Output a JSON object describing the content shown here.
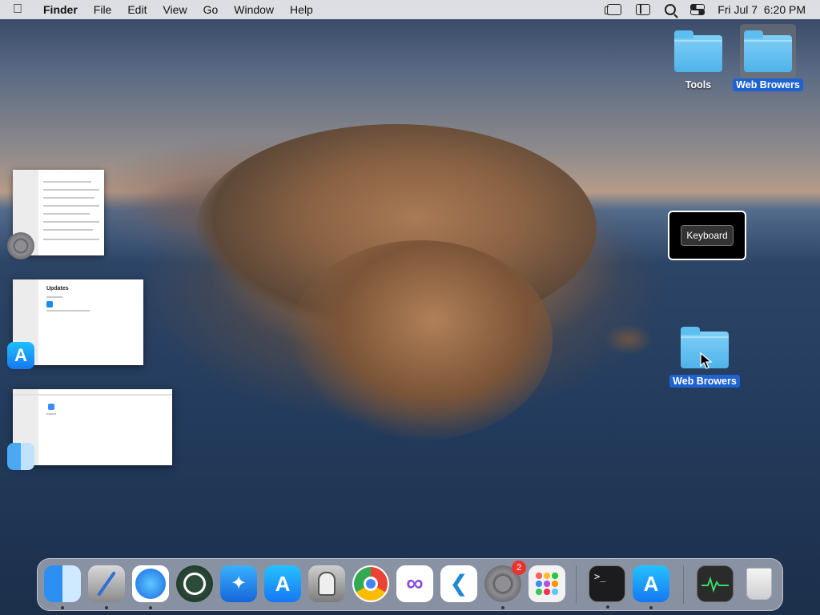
{
  "menubar": {
    "apple_icon": "apple-logo-icon",
    "app_name": "Finder",
    "menus": [
      "File",
      "Edit",
      "View",
      "Go",
      "Window",
      "Help"
    ],
    "status_icons": [
      "stage-manager-icon",
      "sidebar-icon",
      "spotlight-search-icon",
      "control-center-icon"
    ],
    "clock": "Fri Jul 7  6:20 PM"
  },
  "desktop": {
    "icons": [
      {
        "label": "Tools",
        "icon": "folder-icon",
        "selected": false
      },
      {
        "label": "Web Browers",
        "icon": "folder-icon",
        "selected": true
      },
      {
        "label": "Web Browers",
        "icon": "folder-icon",
        "selected": true
      }
    ],
    "popup": {
      "button_label": "Keyboard"
    }
  },
  "stage_manager": {
    "groups": [
      {
        "app_icon": "system-settings-icon"
      },
      {
        "app_icon": "app-store-icon",
        "window_title": "Updates"
      },
      {
        "app_icon": "finder-icon"
      }
    ]
  },
  "dock": {
    "items": [
      {
        "name": "Finder",
        "icon": "finder-icon",
        "running": true
      },
      {
        "name": "Script Editor",
        "icon": "script-editor-icon",
        "running": true
      },
      {
        "name": "Safari",
        "icon": "safari-icon",
        "running": true
      },
      {
        "name": "Time Machine",
        "icon": "time-machine-icon",
        "running": false
      },
      {
        "name": "TestFlight",
        "icon": "testflight-icon",
        "running": false
      },
      {
        "name": "App Store",
        "icon": "app-store-icon",
        "running": false
      },
      {
        "name": "Automator",
        "icon": "automator-icon",
        "running": false
      },
      {
        "name": "Google Chrome",
        "icon": "chrome-icon",
        "running": false
      },
      {
        "name": "Visual Studio",
        "icon": "visual-studio-icon",
        "running": false
      },
      {
        "name": "Visual Studio Code",
        "icon": "vscode-icon",
        "running": false
      },
      {
        "name": "System Settings",
        "icon": "system-settings-icon",
        "running": true,
        "badge": "2"
      },
      {
        "name": "Launchpad",
        "icon": "launchpad-icon",
        "running": false
      },
      {
        "name": "Terminal",
        "icon": "terminal-icon",
        "running": true
      },
      {
        "name": "App Store",
        "icon": "app-store-icon",
        "running": true
      },
      {
        "name": "Activity Monitor",
        "icon": "activity-monitor-icon",
        "running": false
      },
      {
        "name": "Trash",
        "icon": "trash-icon",
        "running": false
      }
    ]
  },
  "colors": {
    "selection": "#1f63d0",
    "folder": "#5dbff0",
    "badge": "#e8332f"
  }
}
